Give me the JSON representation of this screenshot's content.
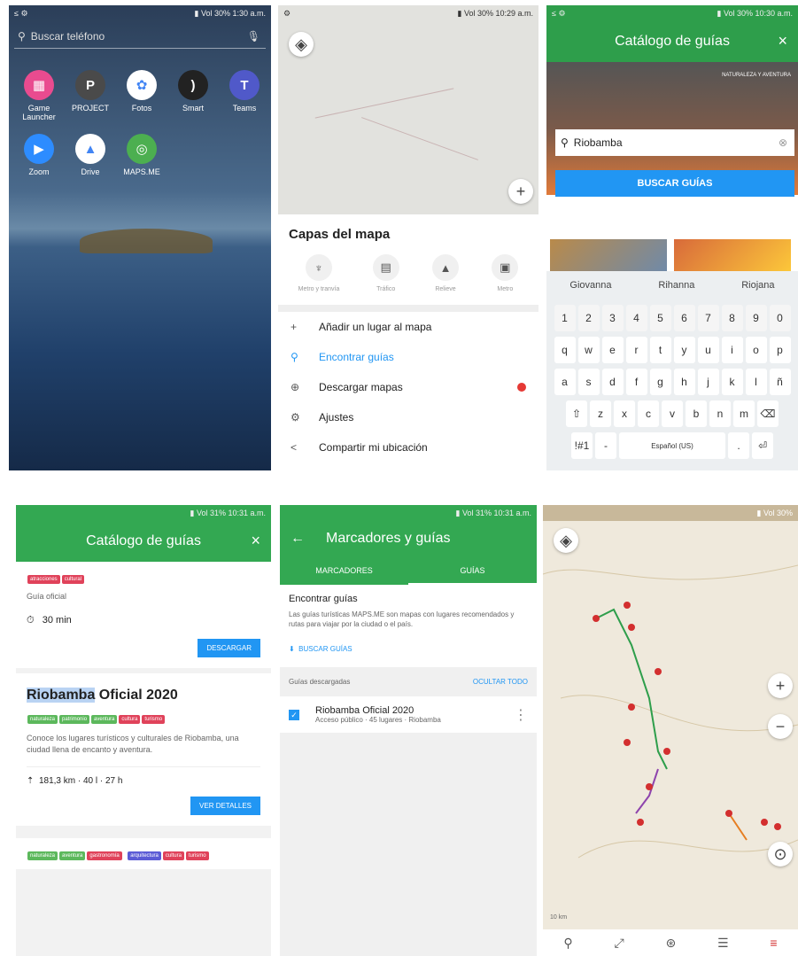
{
  "panel1": {
    "status_left": "≤ ⚙",
    "status_right": "▮ Vol 30% 1:30 a.m.",
    "search_placeholder": "Buscar teléfono",
    "apps": [
      {
        "label": "Game Launcher",
        "color": "#e94b8f",
        "glyph": "▦"
      },
      {
        "label": "PROJECT",
        "color": "#4a4a4a",
        "glyph": "P"
      },
      {
        "label": "Fotos",
        "color": "#fff",
        "glyph": "✿"
      },
      {
        "label": "Smart",
        "color": "#222",
        "glyph": ")"
      },
      {
        "label": "Teams",
        "color": "#5059c9",
        "glyph": "T"
      },
      {
        "label": "Zoom",
        "color": "#2d8cff",
        "glyph": "▶"
      },
      {
        "label": "Drive",
        "color": "#fff",
        "glyph": "▲"
      },
      {
        "label": "MAPS.ME",
        "color": "#4caf50",
        "glyph": "◎"
      }
    ]
  },
  "panel2": {
    "sheet_title": "Capas del mapa",
    "layers": [
      "Metro y tranvía",
      "Tráfico",
      "Relieve",
      "Metro"
    ],
    "menu": [
      {
        "icon": "+",
        "label": "Añadir un lugar al mapa"
      },
      {
        "icon": "⚲",
        "label": "Encontrar guías"
      },
      {
        "icon": "⊕",
        "label": "Descargar mapas"
      },
      {
        "icon": "⚙",
        "label": "Ajustes"
      },
      {
        "icon": "<",
        "label": "Compartir mi ubicación"
      }
    ]
  },
  "panel3": {
    "title": "Catálogo de guías",
    "hero_caption": "NATURALEZA Y AVENTURA",
    "search_value": "Riobamba",
    "search_button": "BUSCAR GUÍAS",
    "suggestions": [
      "Giovanna",
      "Rihanna",
      "Riojana"
    ],
    "keyboard_rows": [
      [
        "1",
        "2",
        "3",
        "4",
        "5",
        "6",
        "7",
        "8",
        "9",
        "0"
      ],
      [
        "q",
        "w",
        "e",
        "r",
        "t",
        "y",
        "u",
        "i",
        "o",
        "p"
      ],
      [
        "a",
        "s",
        "d",
        "f",
        "g",
        "h",
        "j",
        "k",
        "l",
        "ñ"
      ],
      [
        "⇧",
        "z",
        "x",
        "c",
        "v",
        "b",
        "n",
        "m",
        "⌫"
      ],
      [
        "!#1",
        "-",
        "Español (US)",
        ".",
        "⏎"
      ]
    ]
  },
  "panel4": {
    "title": "Catálogo de guías",
    "duration": "30 min",
    "download_label": "DESCARGAR",
    "guide_title_highlight": "Riobamba",
    "guide_title_rest": " Oficial 2020",
    "description": "Conoce los lugares turísticos y culturales de Riobamba, una ciudad llena de encanto y aventura.",
    "stats": "181,3 km · 40 l · 27 h",
    "read_more": "VER DETALLES"
  },
  "panel5": {
    "title": "Marcadores y guías",
    "tab_bookmarks": "MARCADORES",
    "tab_guides": "GUÍAS",
    "find_title": "Encontrar guías",
    "find_desc": "Las guías turísticas MAPS.ME son mapas con lugares recomendados y rutas para viajar por la ciudad o el país.",
    "find_link": "BUSCAR GUÍAS",
    "downloaded_label": "Guías descargadas",
    "hide_all": "OCULTAR TODO",
    "guide_name": "Riobamba Oficial 2020",
    "guide_meta": "Acceso público · 45 lugares · Riobamba"
  },
  "panel6": {
    "scale": "10 km"
  }
}
